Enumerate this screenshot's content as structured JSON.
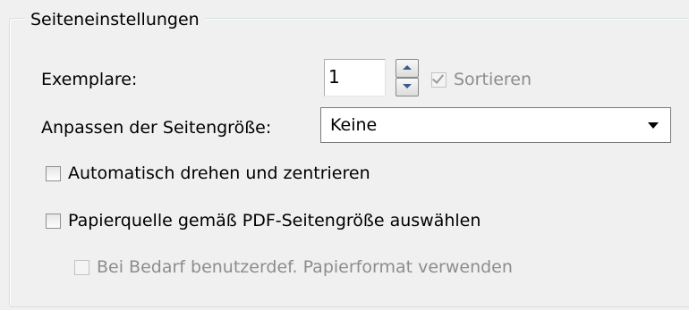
{
  "group_title": "Seiteneinstellungen",
  "copies": {
    "label": "Exemplare:",
    "value": "1",
    "collate_label": "Sortieren",
    "collate_checked": true,
    "collate_enabled": false
  },
  "page_scaling": {
    "label": "Anpassen der Seitengröße:",
    "selected": "Keine"
  },
  "options": {
    "auto_rotate_label": "Automatisch drehen und zentrieren",
    "auto_rotate_checked": false,
    "paper_source_label": "Papierquelle gemäß PDF-Seitengröße auswählen",
    "paper_source_checked": false,
    "custom_paper_label": "Bei Bedarf benutzerdef. Papierformat verwenden",
    "custom_paper_checked": false,
    "custom_paper_enabled": false
  }
}
